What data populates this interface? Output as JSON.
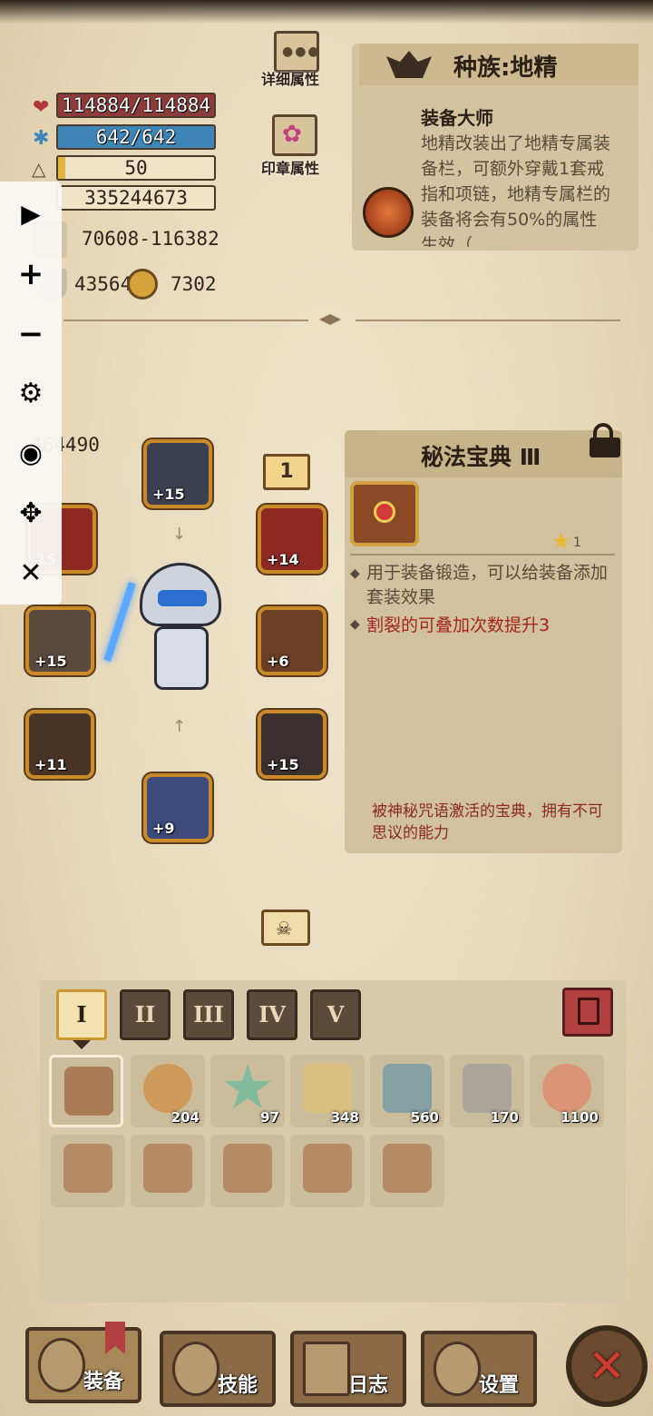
{
  "stats": {
    "hp": "114884/114884",
    "mp": "642/642",
    "level": "50",
    "exp": "335244673",
    "attack": "70608-116382",
    "defense": "43564",
    "stat2": "7302",
    "power": "464490"
  },
  "buttons": {
    "detail_attr": "详细属性",
    "seal_attr": "印章属性"
  },
  "race": {
    "title": "种族:地精",
    "skill_name": "装备大师",
    "skill_desc": "地精改装出了地精专属装备栏，可额外穿戴1套戒指和项链，地精专属栏的装备将会有50%的属性生效（"
  },
  "equipment_slots": [
    {
      "name": "helmet",
      "level": "+15"
    },
    {
      "name": "weapon-left",
      "level": "15"
    },
    {
      "name": "shoulder",
      "level": "+14"
    },
    {
      "name": "bracer",
      "level": "+15"
    },
    {
      "name": "amulet",
      "level": "+6"
    },
    {
      "name": "glove",
      "level": "+11"
    },
    {
      "name": "armor",
      "level": "+15"
    },
    {
      "name": "boots",
      "level": "+9"
    }
  ],
  "set_marker": "1",
  "item": {
    "title": "秘法宝典 Ⅲ",
    "stars": "1",
    "line1": "用于装备锻造，可以给装备添加套装效果",
    "line2": "割裂的可叠加次数提升3",
    "flavor": "被神秘咒语激活的宝典，拥有不可思议的能力"
  },
  "tabs": [
    "I",
    "II",
    "III",
    "IV",
    "V"
  ],
  "inventory_row1": [
    {
      "name": "tome",
      "count": ""
    },
    {
      "name": "potion",
      "count": "204"
    },
    {
      "name": "star-gem",
      "count": "97"
    },
    {
      "name": "scroll",
      "count": "348"
    },
    {
      "name": "crystal",
      "count": "560"
    },
    {
      "name": "shovel",
      "count": "170"
    },
    {
      "name": "ring-stone",
      "count": "1100"
    }
  ],
  "inventory_row2": [
    {
      "name": "book"
    },
    {
      "name": "book"
    },
    {
      "name": "book"
    },
    {
      "name": "book"
    },
    {
      "name": "book"
    }
  ],
  "nav": {
    "equip": "装备",
    "skill": "技能",
    "log": "日志",
    "settings": "设置"
  },
  "colors": {
    "hp": "#8d3b3b",
    "mp": "#3e86b8",
    "level_fill": "#e3b640",
    "accent_red": "#a5251d",
    "parchment": "#e6d7b8"
  }
}
